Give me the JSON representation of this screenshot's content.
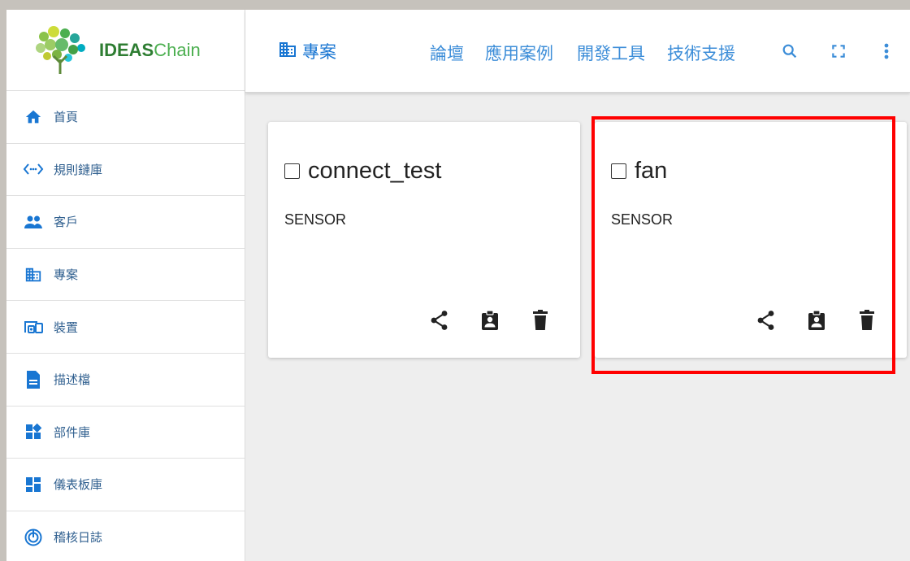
{
  "brand": {
    "name_a": "IDEAS",
    "name_b": "Chain"
  },
  "sidebar": {
    "items": [
      {
        "label": "首頁",
        "icon": "home-icon"
      },
      {
        "label": "規則鏈庫",
        "icon": "code-icon"
      },
      {
        "label": "客戶",
        "icon": "people-icon"
      },
      {
        "label": "專案",
        "icon": "building-icon"
      },
      {
        "label": "裝置",
        "icon": "devices-icon"
      },
      {
        "label": "描述檔",
        "icon": "document-icon"
      },
      {
        "label": "部件庫",
        "icon": "widgets-icon"
      },
      {
        "label": "儀表板庫",
        "icon": "dashboard-icon"
      },
      {
        "label": "稽核日誌",
        "icon": "audit-log-icon"
      }
    ]
  },
  "header": {
    "title": "專案",
    "links": [
      "論壇",
      "應用案例",
      "開發工具",
      "技術支援"
    ]
  },
  "cards": [
    {
      "name": "connect_test",
      "type": "SENSOR"
    },
    {
      "name": "fan",
      "type": "SENSOR"
    }
  ],
  "colors": {
    "accent": "#1976d2",
    "icon": "#3c8dd8",
    "highlight": "#ff0000"
  }
}
